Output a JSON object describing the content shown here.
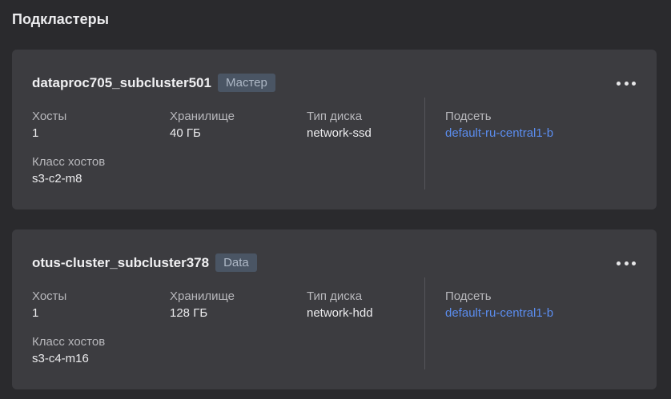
{
  "section": {
    "title": "Подкластеры"
  },
  "colors": {
    "background": "#2a2a2d",
    "card": "#3c3c40",
    "link": "#5b8def",
    "badge_bg": "#4a5564"
  },
  "subclusters": [
    {
      "name": "dataproc705_subcluster501",
      "role_badge": "Мастер",
      "more_icon": "more-horizontal-icon",
      "hosts_label": "Хосты",
      "hosts_value": "1",
      "storage_label": "Хранилище",
      "storage_value": "40 ГБ",
      "disk_label": "Тип диска",
      "disk_value": "network-ssd",
      "subnet_label": "Подсеть",
      "subnet_value": "default-ru-central1-b",
      "class_label": "Класс хостов",
      "class_value": "s3-c2-m8"
    },
    {
      "name": "otus-cluster_subcluster378",
      "role_badge": "Data",
      "more_icon": "more-horizontal-icon",
      "hosts_label": "Хосты",
      "hosts_value": "1",
      "storage_label": "Хранилище",
      "storage_value": "128 ГБ",
      "disk_label": "Тип диска",
      "disk_value": "network-hdd",
      "subnet_label": "Подсеть",
      "subnet_value": "default-ru-central1-b",
      "class_label": "Класс хостов",
      "class_value": "s3-c4-m16"
    }
  ]
}
